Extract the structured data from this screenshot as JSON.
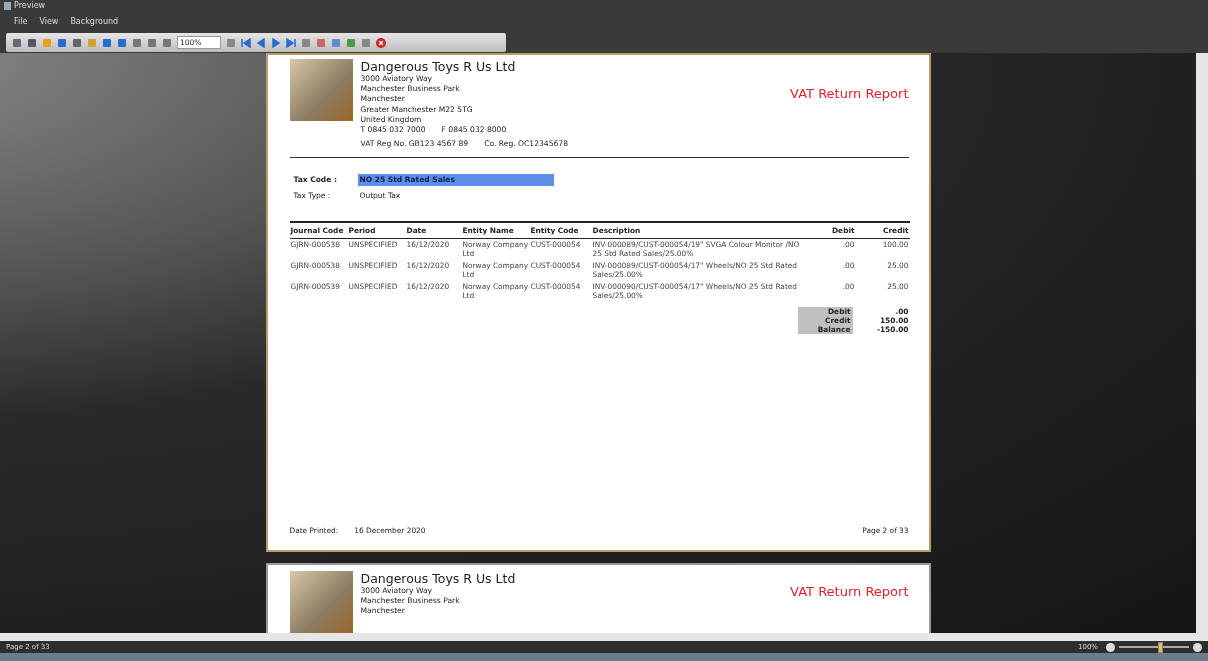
{
  "window": {
    "title": "Preview"
  },
  "menu": [
    "File",
    "View",
    "Background"
  ],
  "toolbar": {
    "zoom_value": "100%"
  },
  "pages": [
    {
      "company": "Dangerous Toys R Us Ltd",
      "address": [
        "3000 Aviatory Way",
        "Manchester Business Park",
        "Manchester",
        "Greater Manchester M22 5TG",
        "United Kingdom"
      ],
      "phones": [
        "T 0845 032 7000",
        "F 0845 032 8000"
      ],
      "registration": [
        "VAT Reg No. GB123 4567 89",
        "Co. Reg. OC12345678"
      ],
      "report_title": "VAT Return Report",
      "fields": [
        {
          "label": "Tax Code :",
          "value": "NO 25 Std Rated Sales",
          "highlighted": true
        },
        {
          "label": "Tax Type :",
          "value": "Output Tax",
          "highlighted": false
        }
      ],
      "table": {
        "columns": [
          "Journal Code",
          "Period",
          "Date",
          "Entity Name",
          "Entity Code",
          "Description",
          "Debit",
          "Credit"
        ],
        "rows": [
          [
            "GJRN-000538",
            "UNSPECIFIED",
            "16/12/2020",
            "Norway Company Ltd",
            "CUST-000054",
            "INV-000089/CUST-000054/19\" SVGA Colour Monitor /NO 25 Std Rated Sales/25.00%",
            ".00",
            "100.00"
          ],
          [
            "GJRN-000538",
            "UNSPECIFIED",
            "16/12/2020",
            "Norway Company Ltd",
            "CUST-000054",
            "INV-000089/CUST-000054/17\" Wheels/NO 25 Std Rated Sales/25.00%",
            ".00",
            "25.00"
          ],
          [
            "GJRN-000539",
            "UNSPECIFIED",
            "16/12/2020",
            "Norway Company Ltd",
            "CUST-000054",
            "INV-000090/CUST-000054/17\" Wheels/NO 25 Std Rated Sales/25.00%",
            ".00",
            "25.00"
          ]
        ]
      },
      "totals": [
        {
          "label": "Debit",
          "value": ".00"
        },
        {
          "label": "Credit",
          "value": "150.00"
        },
        {
          "label": "Balance",
          "value": "-150.00"
        }
      ],
      "footer": {
        "date_label": "Date Printed:",
        "date": "16 December 2020",
        "page": "Page 2 of 33"
      }
    },
    {
      "company": "Dangerous Toys R Us Ltd",
      "address": [
        "3000 Aviatory Way",
        "Manchester Business Park",
        "Manchester"
      ],
      "report_title": "VAT Return Report"
    }
  ],
  "status_bar": {
    "page": "Page 2 of 33",
    "zoom": "100%",
    "zoom_slider": {
      "level": 0.6
    }
  }
}
